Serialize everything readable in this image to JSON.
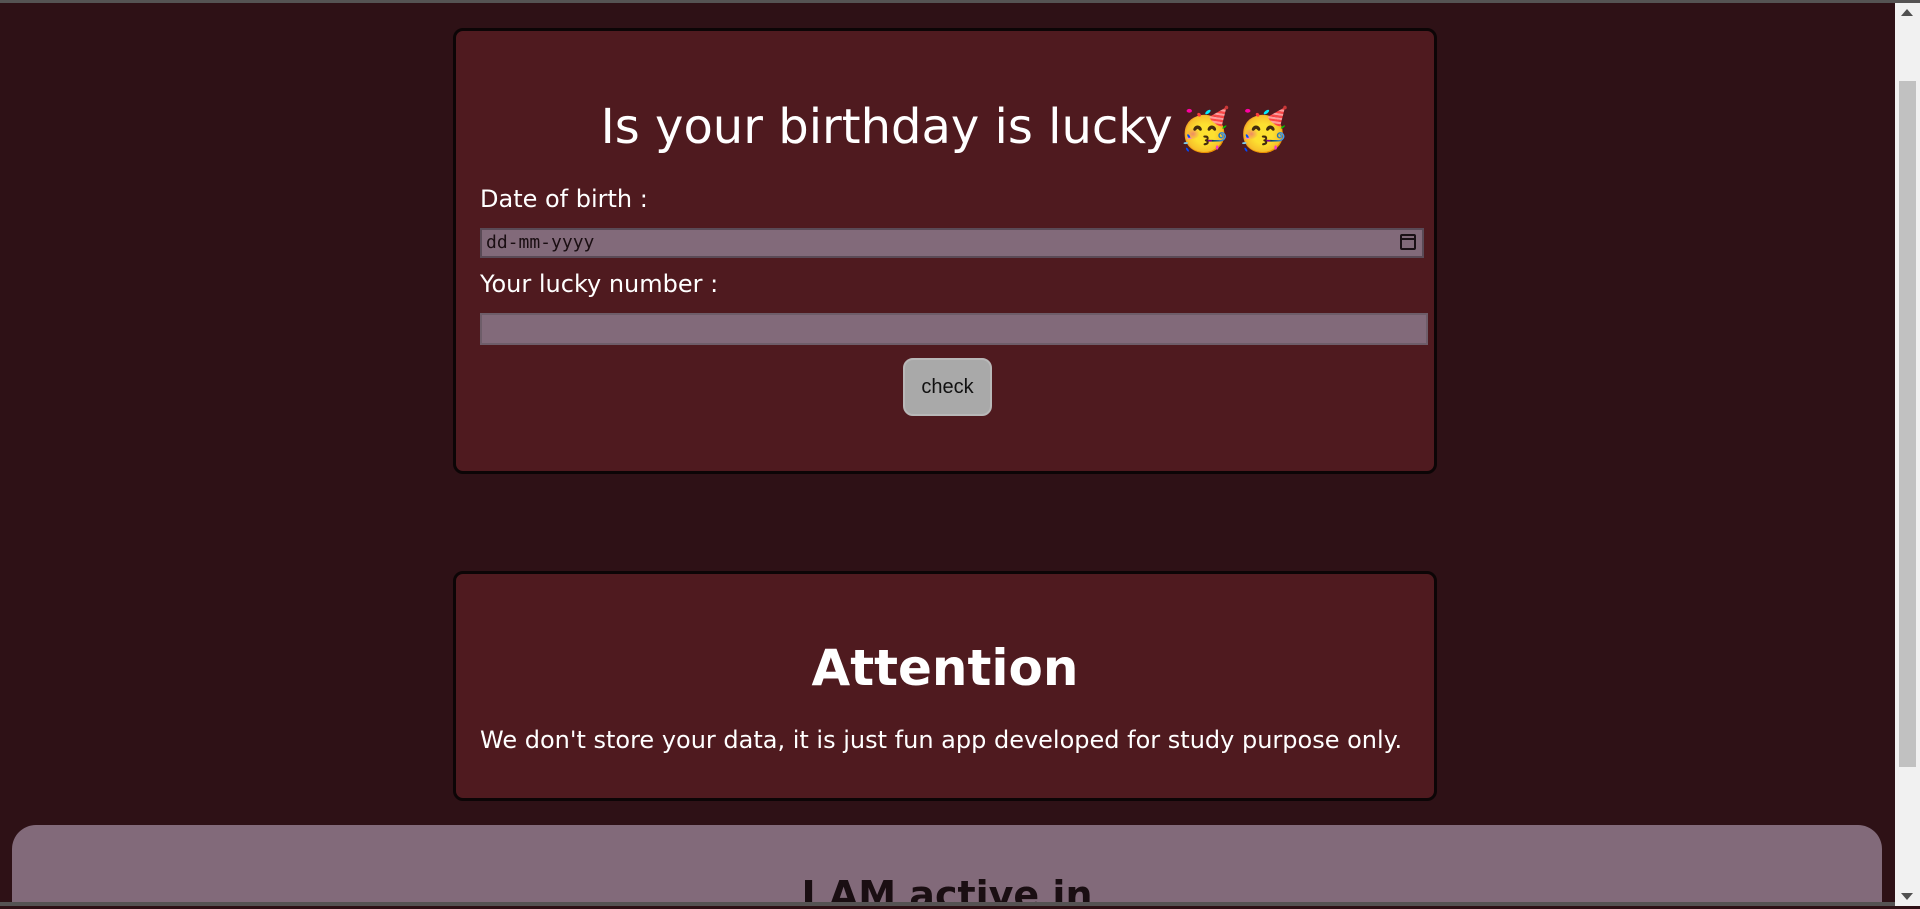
{
  "form": {
    "title": "Is your birthday is lucky",
    "title_emojis": [
      "🥳",
      "🥳"
    ],
    "dob_label": "Date of birth :",
    "dob_placeholder": "dd-mm-yyyy",
    "lucky_label": "Your lucky number :",
    "lucky_value": "",
    "check_label": "check"
  },
  "attention": {
    "title": "Attention",
    "text": "We don't store your data, it is just fun app developed for study purpose only."
  },
  "footer": {
    "title": "I AM active in"
  },
  "colors": {
    "background": "#2e1116",
    "card": "#4f1a1f",
    "input": "#826a7a",
    "button": "#a9a9a9"
  }
}
